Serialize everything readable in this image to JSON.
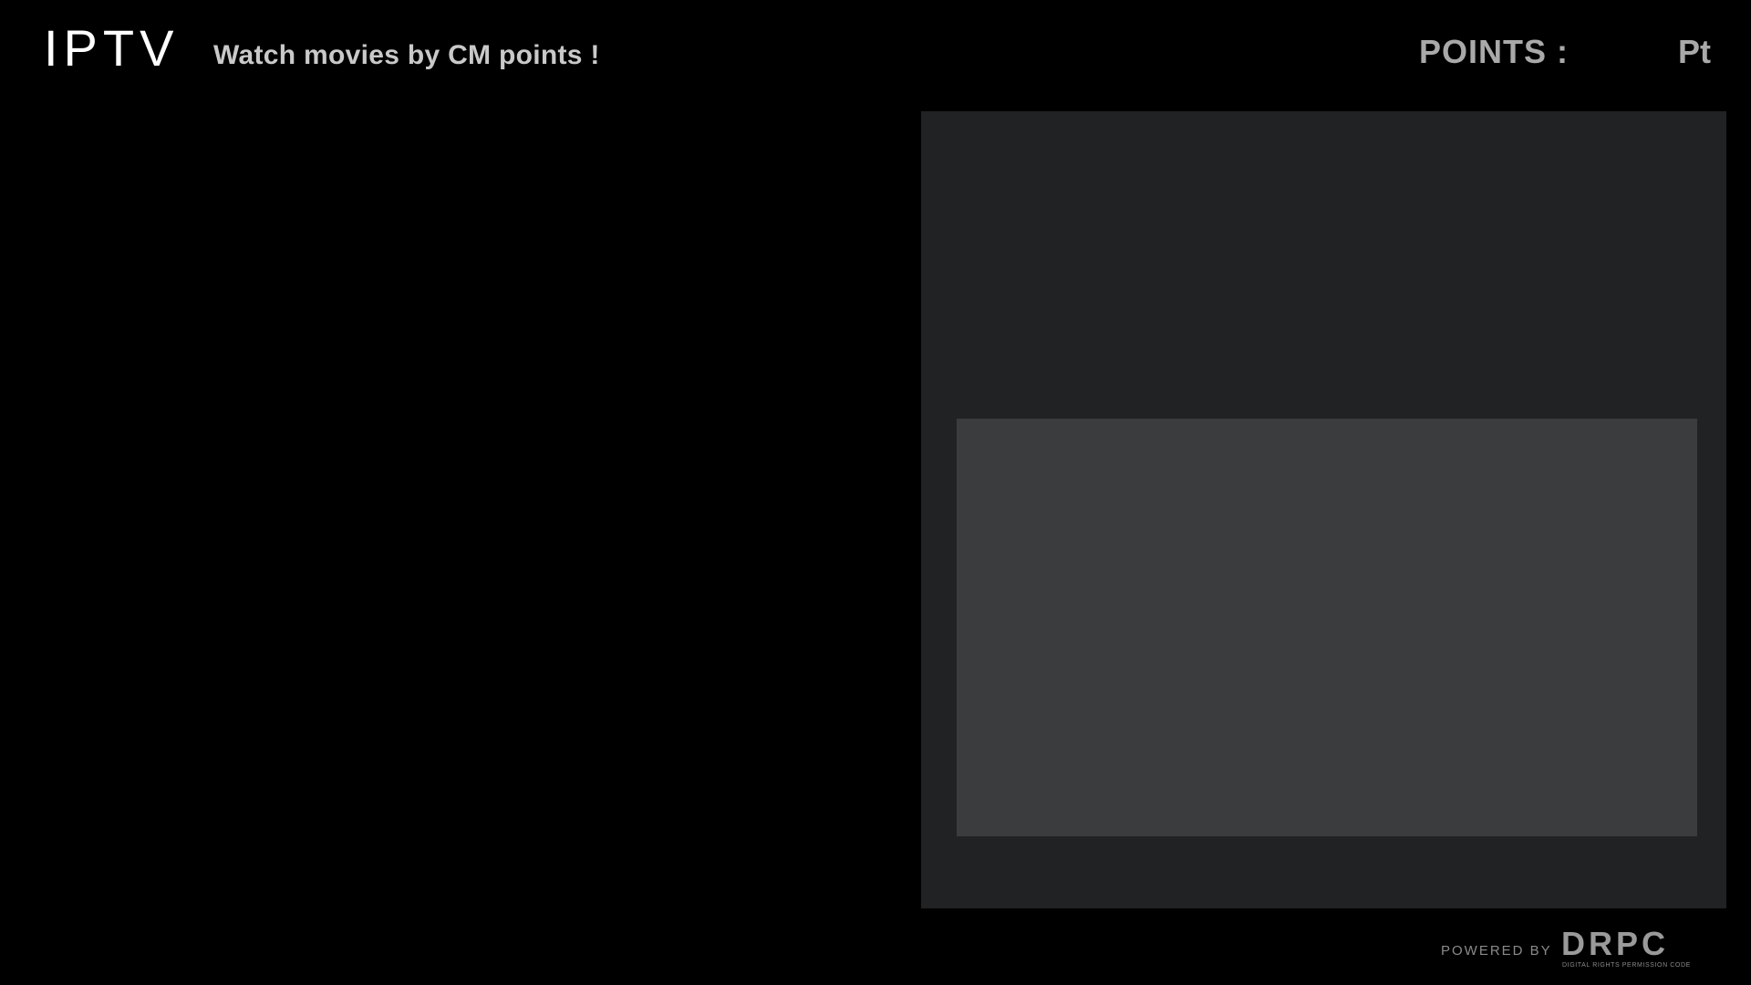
{
  "header": {
    "logo_text": "IPTV",
    "tagline": "Watch movies by CM points !",
    "points_label": "POINTS :",
    "points_value": "",
    "points_unit": "Pt"
  },
  "footer": {
    "powered_by": "POWERED BY",
    "brand_name": "DRPC",
    "brand_subtitle": "DIGITAL RIGHTS PERMISSION CODE"
  },
  "colors": {
    "background": "#000000",
    "panel": "#212224",
    "preview": "#3b3c3e",
    "text_primary": "#c9c9c9",
    "text_secondary": "#a9a9a9",
    "logo": "#ffffff"
  }
}
